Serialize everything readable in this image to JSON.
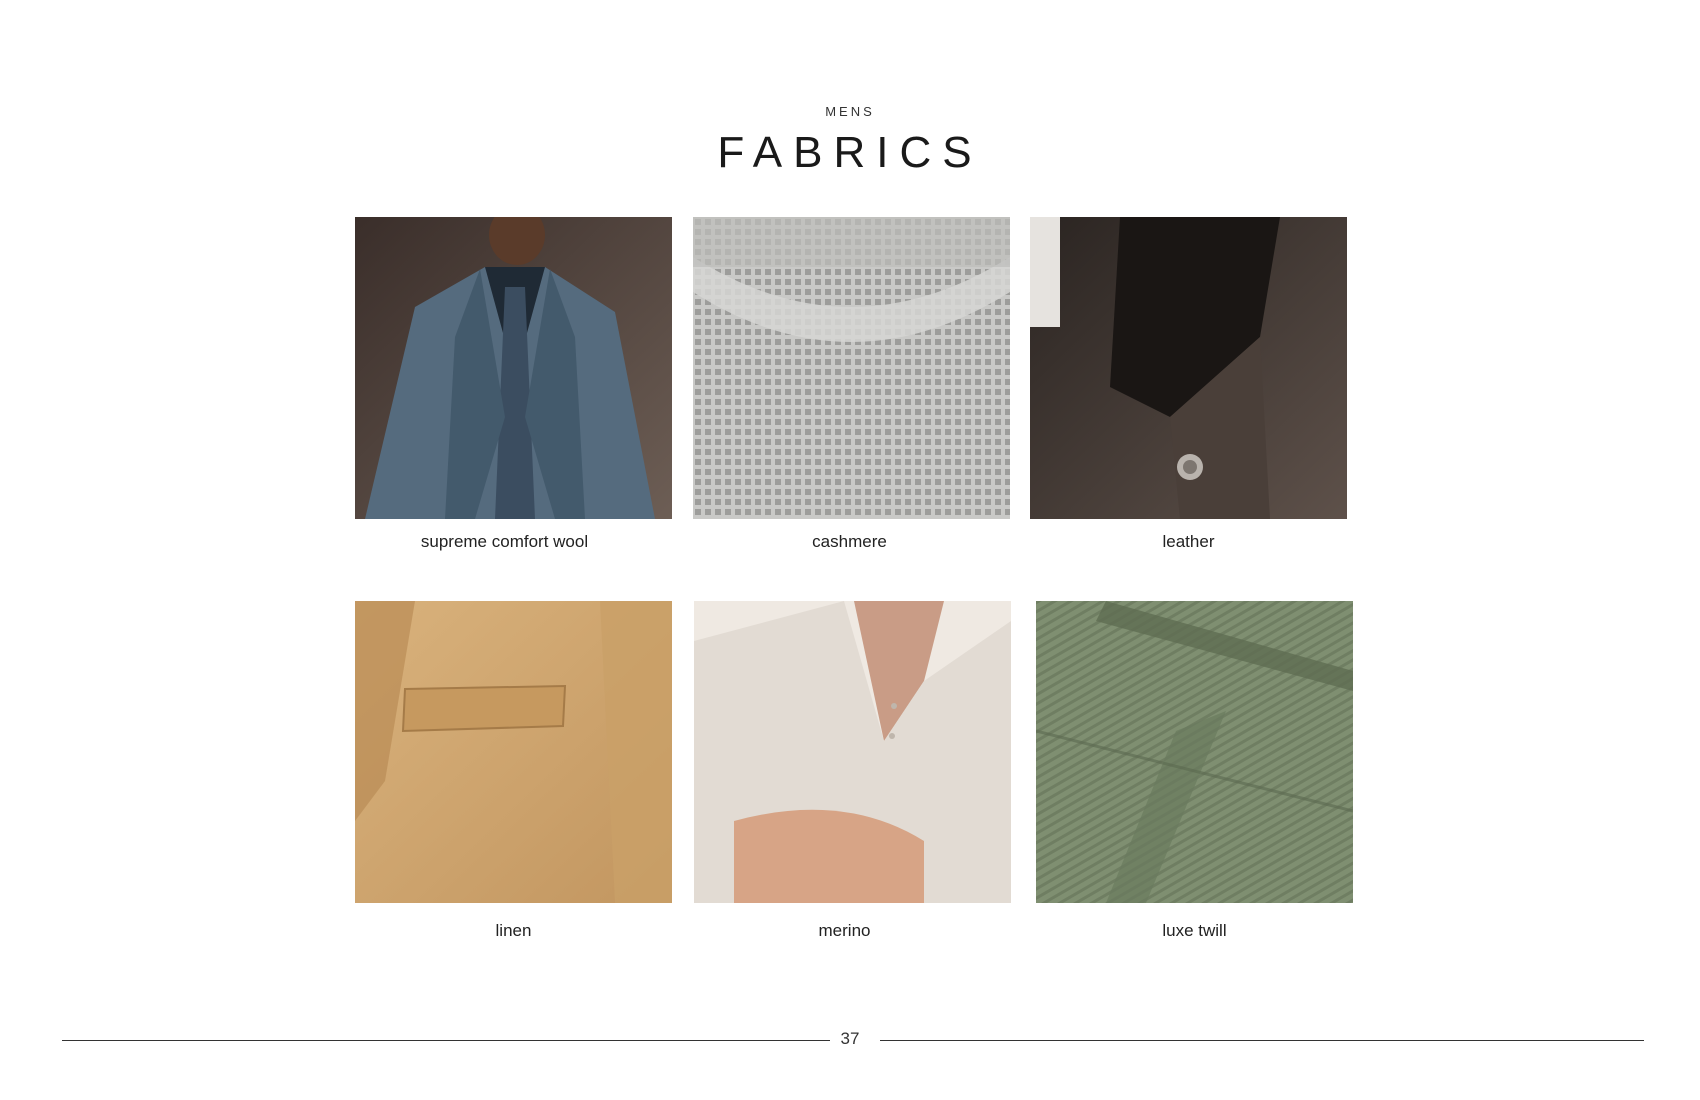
{
  "header": {
    "eyebrow": "MENS",
    "title": "FABRICS"
  },
  "fabrics": [
    {
      "label": "supreme comfort wool",
      "image": "man in blue wool suit and tie"
    },
    {
      "label": "cashmere",
      "image": "grey waffle-knit cashmere sweater collar"
    },
    {
      "label": "leather",
      "image": "brown leather jacket collar with snap button"
    },
    {
      "label": "linen",
      "image": "tan linen blazer pocket"
    },
    {
      "label": "merino",
      "image": "man in cream merino polo"
    },
    {
      "label": "luxe twill",
      "image": "green twill fabric pocket seam"
    }
  ],
  "footer": {
    "page_number": "37"
  },
  "colors": {
    "wool": "#4f6375",
    "cashmere": "#b9b9b7",
    "leather": "#3d3531",
    "linen": "#cfa670",
    "merino": "#e7e0d9",
    "twill": "#7b8a6e"
  }
}
